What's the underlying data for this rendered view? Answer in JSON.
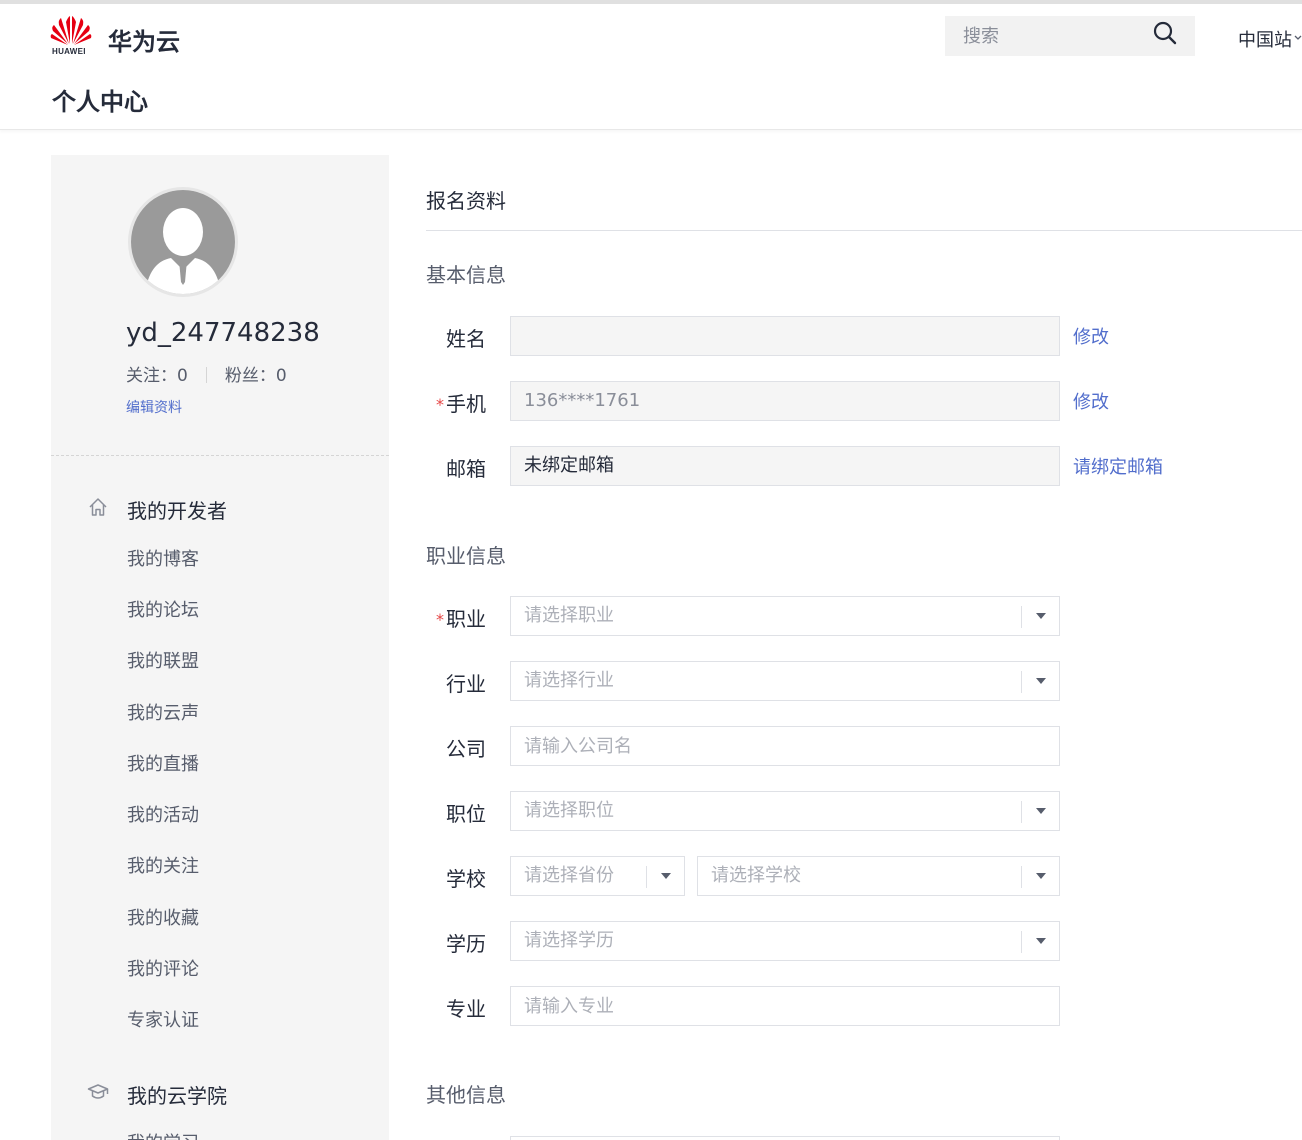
{
  "header": {
    "logo_word": "HUAWEI",
    "brand": "华为云",
    "search_placeholder": "搜索",
    "region": "中国站",
    "page_title": "个人中心"
  },
  "profile": {
    "username": "yd_247748238",
    "follow_label": "关注：",
    "follow_count": "0",
    "fans_label": "粉丝：",
    "fans_count": "0",
    "edit_label": "编辑资料"
  },
  "sidebar": {
    "groups": [
      {
        "label": "我的开发者",
        "icon": "home-icon",
        "items": [
          "我的博客",
          "我的论坛",
          "我的联盟",
          "我的云声",
          "我的直播",
          "我的活动",
          "我的关注",
          "我的收藏",
          "我的评论",
          "专家认证"
        ]
      },
      {
        "label": "我的云学院",
        "icon": "graduation-cap-icon",
        "items": [
          "我的学习"
        ]
      }
    ]
  },
  "form": {
    "section_title": "报名资料",
    "basic": {
      "title": "基本信息",
      "name_label": "姓名",
      "name_value": "",
      "name_action": "修改",
      "phone_label": "手机",
      "phone_value": "136****1761",
      "phone_action": "修改",
      "email_label": "邮箱",
      "email_value": "未绑定邮箱",
      "email_action": "请绑定邮箱"
    },
    "career": {
      "title": "职业信息",
      "job_label": "职业",
      "job_placeholder": "请选择职业",
      "industry_label": "行业",
      "industry_placeholder": "请选择行业",
      "company_label": "公司",
      "company_placeholder": "请输入公司名",
      "position_label": "职位",
      "position_placeholder": "请选择职位",
      "school_label": "学校",
      "province_placeholder": "请选择省份",
      "school_placeholder": "请选择学校",
      "education_label": "学历",
      "education_placeholder": "请选择学历",
      "major_label": "专业",
      "major_placeholder": "请输入专业"
    },
    "other": {
      "title": "其他信息"
    }
  },
  "colors": {
    "link": "#526ecc",
    "required": "#e54545",
    "sidebar_bg": "#f5f5f5",
    "logo_red": "#e60012"
  }
}
